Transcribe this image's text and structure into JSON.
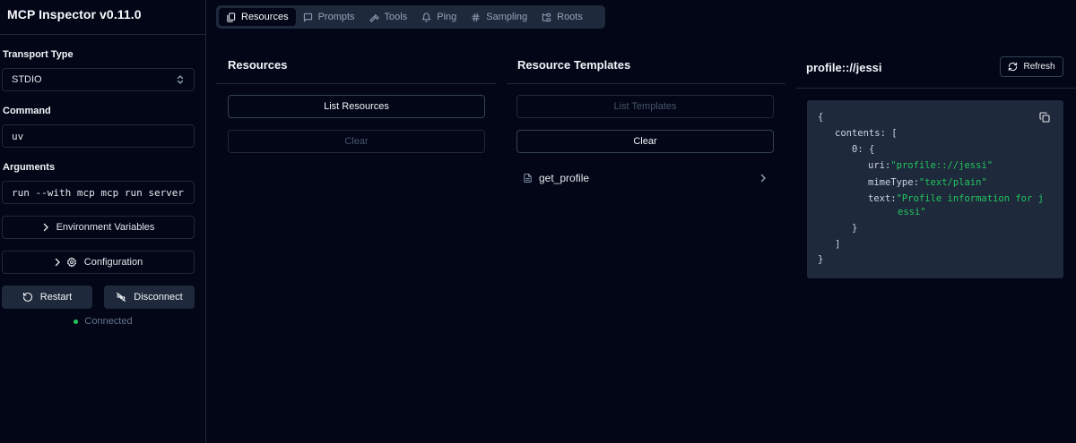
{
  "app": {
    "title": "MCP Inspector v0.11.0"
  },
  "sidebar": {
    "transport_label": "Transport Type",
    "transport_value": "STDIO",
    "command_label": "Command",
    "command_value": "uv",
    "arguments_label": "Arguments",
    "arguments_value": "run --with mcp mcp run server.py",
    "env_button": "Environment Variables",
    "config_button": "Configuration",
    "restart_button": "Restart",
    "disconnect_button": "Disconnect",
    "status_text": "Connected",
    "status_color": "#22c55e"
  },
  "tabs": [
    {
      "label": "Resources",
      "icon": "files-icon",
      "active": true
    },
    {
      "label": "Prompts",
      "icon": "message-square-icon"
    },
    {
      "label": "Tools",
      "icon": "hammer-icon"
    },
    {
      "label": "Ping",
      "icon": "bell-icon"
    },
    {
      "label": "Sampling",
      "icon": "hash-icon"
    },
    {
      "label": "Roots",
      "icon": "folder-tree-icon"
    }
  ],
  "resources": {
    "title": "Resources",
    "list_button": "List Resources",
    "clear_button": "Clear"
  },
  "templates": {
    "title": "Resource Templates",
    "list_button": "List Templates",
    "clear_button": "Clear",
    "items": [
      {
        "name": "get_profile",
        "icon": "file-text-icon"
      }
    ]
  },
  "detail": {
    "title": "profile:://jessi",
    "refresh_button": "Refresh",
    "json": {
      "open_brace": "{",
      "contents_key": "contents:",
      "open_bracket": "[",
      "index_key": "0:",
      "item_open": "{",
      "uri_key": "uri:",
      "uri_value": "\"profile:://jessi\"",
      "mime_key": "mimeType:",
      "mime_value": "\"text/plain\"",
      "text_key": "text:",
      "text_value_1": "\"Profile information for j",
      "text_value_2": "essi\"",
      "item_close": "}",
      "close_bracket": "]",
      "close_brace": "}"
    }
  }
}
